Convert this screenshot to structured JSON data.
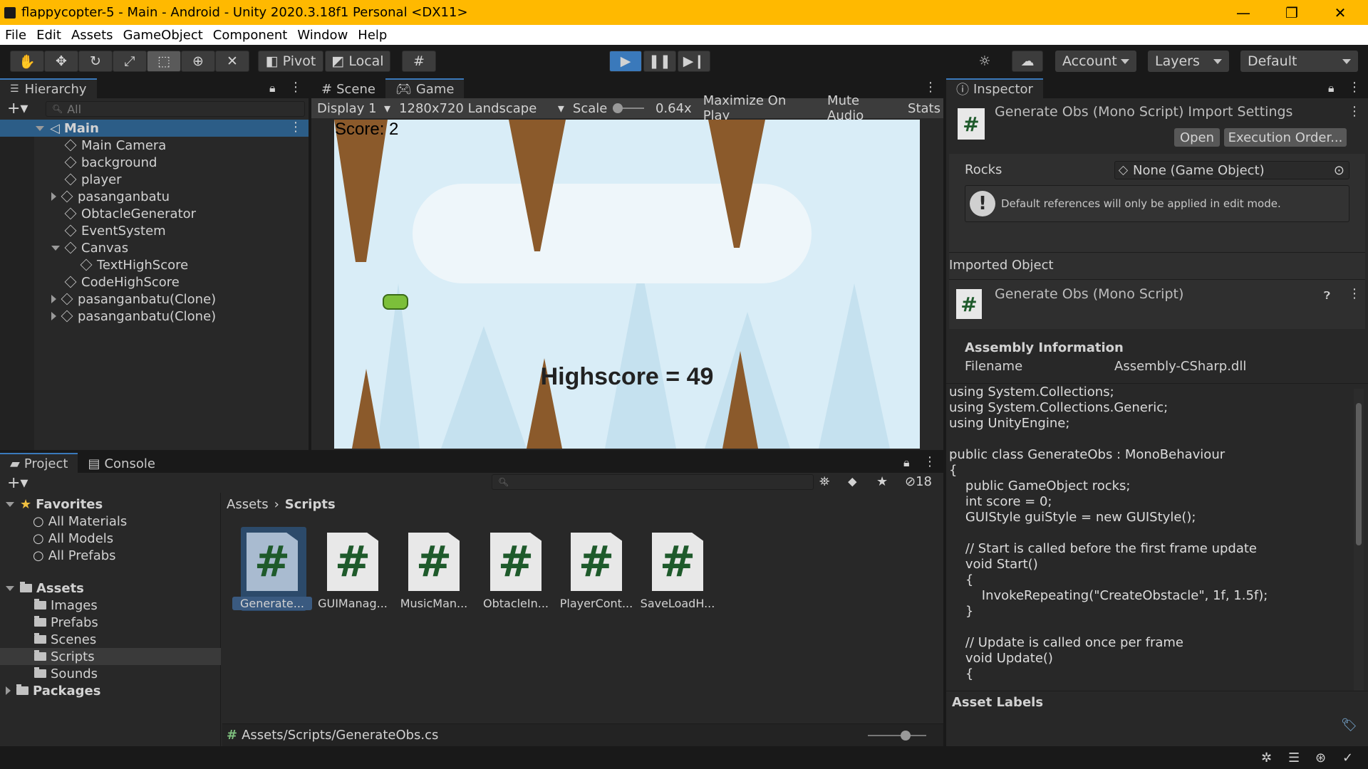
{
  "window": {
    "title": "flappycopter-5 - Main - Android - Unity 2020.3.18f1 Personal <DX11>"
  },
  "menu": [
    "File",
    "Edit",
    "Assets",
    "GameObject",
    "Component",
    "Window",
    "Help"
  ],
  "toolbar": {
    "pivot": "Pivot",
    "local": "Local",
    "account": "Account",
    "layers": "Layers",
    "layout": "Default"
  },
  "hierarchy": {
    "tab": "Hierarchy",
    "search_placeholder": "All",
    "scene": "Main",
    "items": [
      "Main Camera",
      "background",
      "player",
      "pasanganbatu",
      "ObtacleGenerator",
      "EventSystem",
      "Canvas",
      "TextHighScore",
      "CodeHighScore",
      "pasanganbatu(Clone)",
      "pasanganbatu(Clone)"
    ]
  },
  "game_view": {
    "tab_scene": "Scene",
    "tab_game": "Game",
    "display": "Display 1",
    "resolution": "1280x720 Landscape",
    "scale_label": "Scale",
    "scale_value": "0.64x",
    "maximize": "Maximize On Play",
    "mute": "Mute Audio",
    "stats": "Stats",
    "score": "Score: 2",
    "highscore": "Highscore = 49"
  },
  "inspector": {
    "tab": "Inspector",
    "title": "Generate Obs (Mono Script) Import Settings",
    "open": "Open",
    "exec_order": "Execution Order...",
    "rocks_label": "Rocks",
    "rocks_value": "None (Game Object)",
    "warning": "Default references will only be applied in edit mode.",
    "imported_header": "Imported Object",
    "imported_name": "Generate Obs (Mono Script)",
    "assembly_header": "Assembly Information",
    "filename_label": "Filename",
    "filename_value": "Assembly-CSharp.dll",
    "code": [
      "using System.Collections;",
      "using System.Collections.Generic;",
      "using UnityEngine;",
      "",
      "public class GenerateObs : MonoBehaviour",
      "{",
      "    public GameObject rocks;",
      "    int score = 0;",
      "    GUIStyle guiStyle = new GUIStyle();",
      "",
      "    // Start is called before the first frame update",
      "    void Start()",
      "    {",
      "        InvokeRepeating(\"CreateObstacle\", 1f, 1.5f);",
      "    }",
      "",
      "    // Update is called once per frame",
      "    void Update()",
      "    {"
    ],
    "asset_labels": "Asset Labels"
  },
  "project": {
    "tab_project": "Project",
    "tab_console": "Console",
    "hidden_count": "18",
    "favorites": "Favorites",
    "fav_items": [
      "All Materials",
      "All Models",
      "All Prefabs"
    ],
    "assets": "Assets",
    "asset_folders": [
      "Images",
      "Prefabs",
      "Scenes",
      "Scripts",
      "Sounds"
    ],
    "packages": "Packages",
    "breadcrumb_root": "Assets",
    "breadcrumb_current": "Scripts",
    "files": [
      "Generate...",
      "GUIManag...",
      "MusicMan...",
      "ObtacleIn...",
      "PlayerCont...",
      "SaveLoadH..."
    ],
    "status_path": "Assets/Scripts/GenerateObs.cs"
  },
  "colors": {
    "title_bar": "#ffb900",
    "selection": "#2c5d87",
    "accent": "#3a79bb",
    "sky": "#d9edf7",
    "rock": "#8b5a2b"
  }
}
